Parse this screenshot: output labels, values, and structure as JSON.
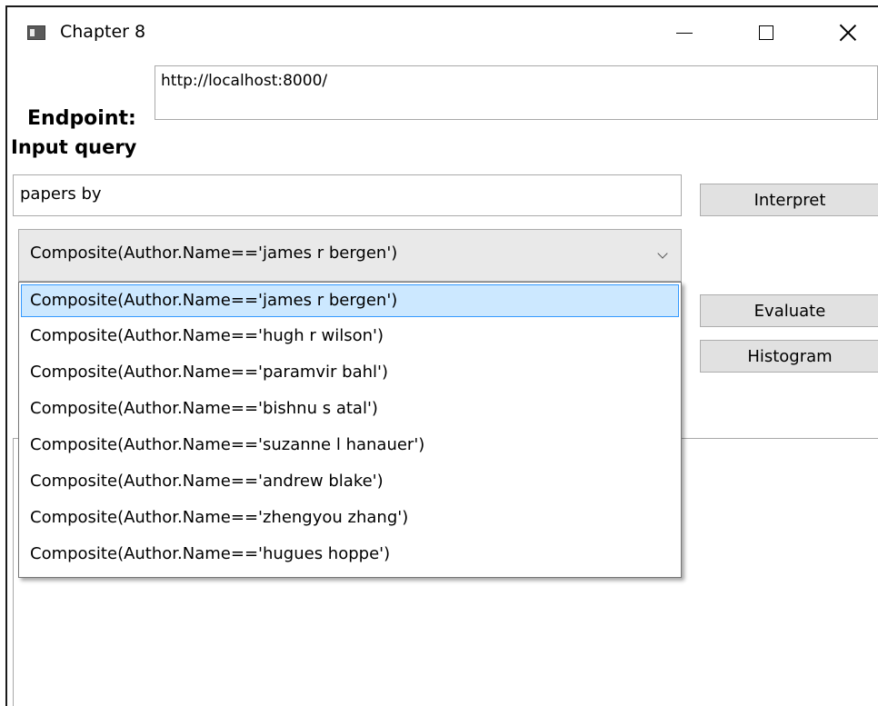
{
  "window": {
    "title": "Chapter 8"
  },
  "endpoint": {
    "label": "Endpoint:",
    "value": "http://localhost:8000/"
  },
  "query": {
    "label": "Input query",
    "value": "papers by"
  },
  "buttons": {
    "interpret": "Interpret",
    "evaluate": "Evaluate",
    "histogram": "Histogram"
  },
  "combo": {
    "selected": "Composite(Author.Name=='james r bergen')",
    "options": [
      "Composite(Author.Name=='james r bergen')",
      "Composite(Author.Name=='hugh r wilson')",
      "Composite(Author.Name=='paramvir bahl')",
      "Composite(Author.Name=='bishnu s atal')",
      "Composite(Author.Name=='suzanne l hanauer')",
      "Composite(Author.Name=='andrew blake')",
      "Composite(Author.Name=='zhengyou zhang')",
      "Composite(Author.Name=='hugues hoppe')"
    ],
    "highlighted_index": 0
  },
  "colors": {
    "selection_fill": "#cce8ff",
    "selection_border": "#3399ff",
    "button_face": "#e1e1e1"
  }
}
